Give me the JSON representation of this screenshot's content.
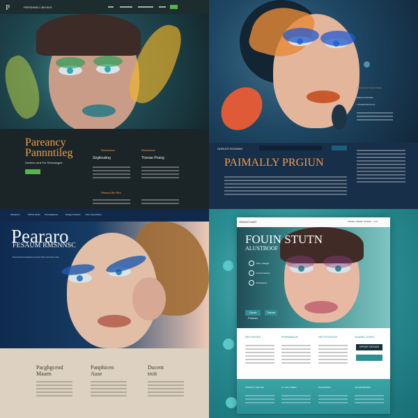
{
  "q1": {
    "logo": "P",
    "nav_brand": "PERSHWELL BIOSKS",
    "nav": [
      "",
      ""
    ],
    "title1": "Pareancy",
    "title2": "Pannntileg",
    "subtitle": "Denfers cenk Pxr Remoiargue",
    "col1": "Reesricecx",
    "col2": "Sirgibcaling",
    "col3": "Ttxerae Pruing",
    "col4": "Resecs Bxr Rirs"
  },
  "q2": {
    "header": "DORUTE ROOMEN",
    "title": "PAIMALLY PRGIUN",
    "side_title": "Hlxla Rosoc Ctrssprt Roleq",
    "side_items": [
      "Rrlloncs Rucrsatn",
      "Tnrsuatll Fsirnoncrs"
    ]
  },
  "q3": {
    "nav": [
      "Panaeuno",
      "Pohlne Grtiss",
      "Pounatasanes",
      "Srtngp Gmhaxin",
      "Yorer Porocottims"
    ],
    "title1": "Peararo",
    "title2": "FESAUM RMSNNSC",
    "intro": "Proocnrecsnt asolersa. Frosec Pan ssrxooinn Ctts",
    "col1_title": "Pacghgcend",
    "col1_sub": "Maaen",
    "col2_title": "Panphicen",
    "col2_sub": "Ause",
    "col3_title": "Ducent",
    "col3_sub": "troit"
  },
  "q4": {
    "nav_brand": "GRACKTUMT",
    "nav": [
      "POKES",
      "NNMM",
      "NOARS",
      "NAN"
    ],
    "title1": "FOUIN STUTN",
    "title2": "ALUSTBOOF",
    "feat1": "Wso: Gaiager",
    "feat2": "Coxrnvrseinen",
    "feat3": "Reeoaoues",
    "btn1": "Carntr Pruitom",
    "btn2": "Ttanne",
    "col1": "RETSHOES",
    "col2": "PORMARON",
    "col3": "RETSTHOOSV",
    "col4": "SUANEL EHEN",
    "cta": "DPSNT DEOAS",
    "foot": [
      "SCRNM N SRTVES",
      "AL THR VOBES",
      "MCHUMTES",
      "SIN MSHEHPES"
    ]
  },
  "colors": {
    "teal": "#1c8d86",
    "green": "#58b44c",
    "orange": "#e49155",
    "navy": "#1b3353"
  }
}
